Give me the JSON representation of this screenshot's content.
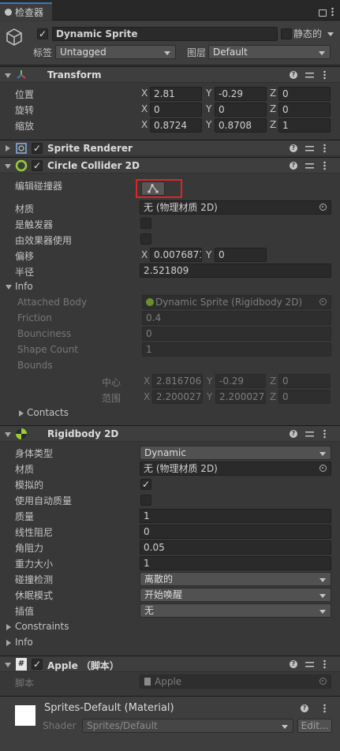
{
  "tab": {
    "label": "检查器"
  },
  "object": {
    "name": "Dynamic Sprite",
    "static_label": "静态的",
    "tag_label": "标签",
    "tag_value": "Untagged",
    "layer_label": "图层",
    "layer_value": "Default"
  },
  "transform": {
    "title": "Transform",
    "position_label": "位置",
    "rotation_label": "旋转",
    "scale_label": "缩放",
    "position": {
      "x": "2.81",
      "y": "-0.29",
      "z": "0"
    },
    "rotation": {
      "x": "0",
      "y": "0",
      "z": "0"
    },
    "scale": {
      "x": "0.8724",
      "y": "0.8708",
      "z": "1"
    }
  },
  "axes": {
    "x": "X",
    "y": "Y",
    "z": "Z"
  },
  "sprite_renderer": {
    "title": "Sprite Renderer"
  },
  "circle_collider": {
    "title": "Circle Collider 2D",
    "edit_label": "编辑碰撞器",
    "material_label": "材质",
    "material_value": "无 (物理材质 2D)",
    "is_trigger_label": "是触发器",
    "used_by_effector_label": "由效果器使用",
    "offset_label": "偏移",
    "offset_x": "0.0076871",
    "offset_y": "0",
    "radius_label": "半径",
    "radius_value": "2.521809",
    "info_label": "Info",
    "attached_body_label": "Attached Body",
    "attached_body_value": "Dynamic Sprite (Rigidbody 2D)",
    "friction_label": "Friction",
    "friction_value": "0.4",
    "bounciness_label": "Bounciness",
    "bounciness_value": "0",
    "shape_count_label": "Shape Count",
    "shape_count_value": "1",
    "bounds_label": "Bounds",
    "center_label": "中心",
    "center": {
      "x": "2.816706",
      "y": "-0.29",
      "z": "0"
    },
    "extent_label": "范围",
    "extent": {
      "x": "2.200027",
      "y": "2.200027",
      "z": "0"
    },
    "contacts_label": "Contacts"
  },
  "rigidbody": {
    "title": "Rigidbody 2D",
    "body_type_label": "身体类型",
    "body_type_value": "Dynamic",
    "material_label": "材质",
    "material_value": "无 (物理材质 2D)",
    "simulated_label": "模拟的",
    "auto_mass_label": "使用自动质量",
    "mass_label": "质量",
    "mass_value": "1",
    "linear_drag_label": "线性阻尼",
    "linear_drag_value": "0",
    "angular_drag_label": "角阻力",
    "angular_drag_value": "0.05",
    "gravity_label": "重力大小",
    "gravity_value": "1",
    "collision_label": "碰撞检测",
    "collision_value": "离散的",
    "sleep_label": "休眠模式",
    "sleep_value": "开始唤醒",
    "interpolate_label": "插值",
    "interpolate_value": "无",
    "constraints_label": "Constraints",
    "info_label": "Info"
  },
  "script": {
    "title": "Apple （脚本）",
    "script_label": "脚本",
    "script_value": "Apple"
  },
  "material": {
    "title": "Sprites-Default (Material)",
    "shader_label": "Shader",
    "shader_value": "Sprites/Default",
    "edit_label": "Edit..."
  },
  "colors": {
    "accent": "#3a79bb",
    "highlight_box": "#e02424",
    "collider_green": "#9acd32"
  }
}
